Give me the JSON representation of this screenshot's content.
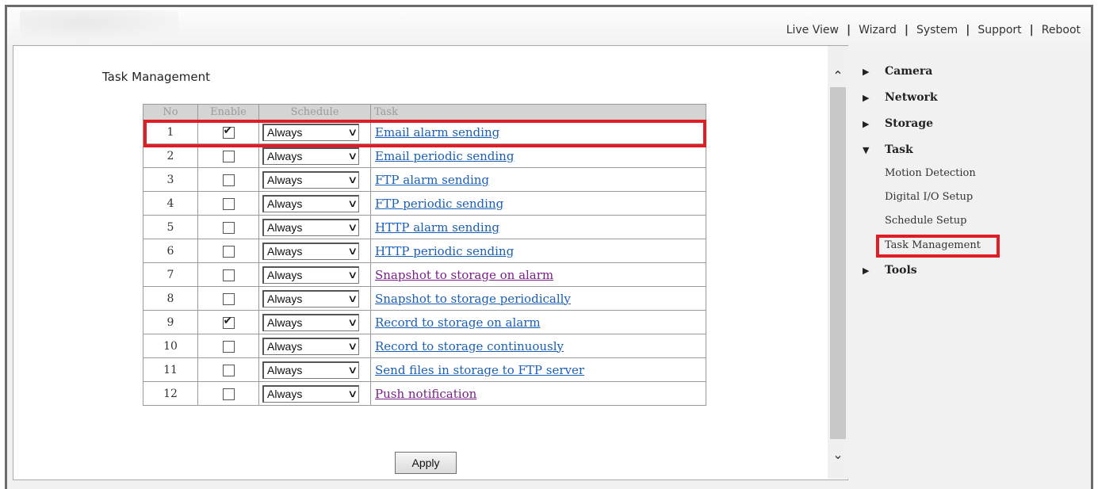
{
  "top_nav": [
    "Live View",
    "Wizard",
    "System",
    "Support",
    "Reboot"
  ],
  "page_title": "Task Management",
  "table": {
    "headers": [
      "No",
      "Enable",
      "Schedule",
      "Task"
    ],
    "rows": [
      {
        "no": "1",
        "enabled": true,
        "schedule": "Always",
        "task": "Email alarm sending",
        "visited": false
      },
      {
        "no": "2",
        "enabled": false,
        "schedule": "Always",
        "task": "Email periodic sending",
        "visited": false
      },
      {
        "no": "3",
        "enabled": false,
        "schedule": "Always",
        "task": "FTP alarm sending",
        "visited": false
      },
      {
        "no": "4",
        "enabled": false,
        "schedule": "Always",
        "task": "FTP periodic sending",
        "visited": false
      },
      {
        "no": "5",
        "enabled": false,
        "schedule": "Always",
        "task": "HTTP alarm sending",
        "visited": false
      },
      {
        "no": "6",
        "enabled": false,
        "schedule": "Always",
        "task": "HTTP periodic sending",
        "visited": false
      },
      {
        "no": "7",
        "enabled": false,
        "schedule": "Always",
        "task": "Snapshot to storage on alarm",
        "visited": true
      },
      {
        "no": "8",
        "enabled": false,
        "schedule": "Always",
        "task": "Snapshot to storage periodically",
        "visited": false
      },
      {
        "no": "9",
        "enabled": true,
        "schedule": "Always",
        "task": "Record to storage on alarm",
        "visited": false
      },
      {
        "no": "10",
        "enabled": false,
        "schedule": "Always",
        "task": "Record to storage continuously",
        "visited": false
      },
      {
        "no": "11",
        "enabled": false,
        "schedule": "Always",
        "task": "Send files in storage to FTP server",
        "visited": false
      },
      {
        "no": "12",
        "enabled": false,
        "schedule": "Always",
        "task": "Push notification",
        "visited": true
      }
    ]
  },
  "apply_label": "Apply",
  "sidebar": {
    "items": [
      {
        "label": "Camera",
        "expanded": false
      },
      {
        "label": "Network",
        "expanded": false
      },
      {
        "label": "Storage",
        "expanded": false
      },
      {
        "label": "Task",
        "expanded": true
      },
      {
        "label": "Tools",
        "expanded": false
      }
    ],
    "task_children": [
      "Motion Detection",
      "Digital I/O Setup",
      "Schedule Setup",
      "Task Management"
    ],
    "active_child": "Task Management"
  },
  "colors": {
    "highlight": "#e01c24",
    "link": "#1a5fb4",
    "visited_link": "#7a1f8a"
  }
}
